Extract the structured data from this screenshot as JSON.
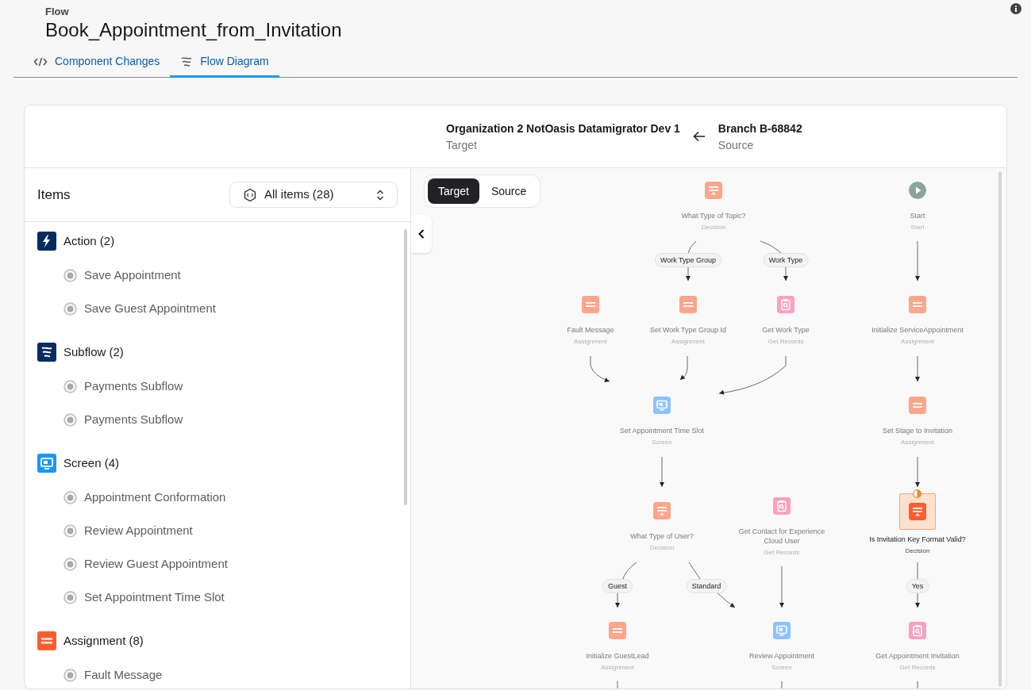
{
  "header": {
    "eyebrow": "Flow",
    "title": "Book_Appointment_from_Invitation"
  },
  "tabs": [
    {
      "label": "Component Changes",
      "kind": "code",
      "selected": false
    },
    {
      "label": "Flow Diagram",
      "kind": "flow",
      "selected": true
    }
  ],
  "comparison": {
    "target": {
      "name": "Organization 2 NotOasis Datamigrator Dev 1",
      "role": "Target"
    },
    "source": {
      "name": "Branch B-68842",
      "role": "Source"
    }
  },
  "items_panel": {
    "title": "Items",
    "filter": "All items (28)",
    "groups": [
      {
        "label": "Action (2)",
        "kind": "action",
        "color": "#032d60",
        "items": [
          "Save Appointment",
          "Save Guest Appointment"
        ]
      },
      {
        "label": "Subflow (2)",
        "kind": "subflow",
        "color": "#032d60",
        "items": [
          "Payments Subflow",
          "Payments Subflow"
        ]
      },
      {
        "label": "Screen (4)",
        "kind": "screen",
        "color": "#1b96ff",
        "items": [
          "Appointment Conformation",
          "Review Appointment",
          "Review Guest Appointment",
          "Set Appointment Time Slot"
        ]
      },
      {
        "label": "Assignment (8)",
        "kind": "assignment",
        "color": "#ff5d2d",
        "items": [
          "Fault Message"
        ]
      }
    ]
  },
  "diagram": {
    "view_toggle": [
      {
        "label": "Target",
        "selected": true
      },
      {
        "label": "Source",
        "selected": false
      }
    ],
    "nodes": [
      {
        "label": "What Type of Topic?",
        "type_label": "Decision",
        "kind": "decision",
        "highlighted": false
      },
      {
        "label": "Start",
        "type_label": "Start",
        "kind": "start",
        "highlighted": false
      },
      {
        "label": "Fault Message",
        "type_label": "Assignment",
        "kind": "assignment",
        "highlighted": false
      },
      {
        "label": "Set Work Type Group Id",
        "type_label": "Assignment",
        "kind": "assignment",
        "highlighted": false
      },
      {
        "label": "Get Work Type",
        "type_label": "Get Records",
        "kind": "records",
        "highlighted": false
      },
      {
        "label": "Initialize ServiceAppointment",
        "type_label": "Assignment",
        "kind": "assignment",
        "highlighted": false
      },
      {
        "label": "Set Appointment Time Slot",
        "type_label": "Screen",
        "kind": "screen",
        "highlighted": false
      },
      {
        "label": "Set Stage to Invitation",
        "type_label": "Assignment",
        "kind": "assignment",
        "highlighted": false
      },
      {
        "label": "What Type of User?",
        "type_label": "Decision",
        "kind": "decision",
        "highlighted": false
      },
      {
        "label": "Get Contact for Experience Cloud User",
        "type_label": "Get Records",
        "kind": "records",
        "highlighted": false
      },
      {
        "label": "Is Invitation Key Format Valid?",
        "type_label": "Decision",
        "kind": "decision",
        "highlighted": true
      },
      {
        "label": "Initialize GuestLead",
        "type_label": "Assignment",
        "kind": "assignment",
        "highlighted": false
      },
      {
        "label": "Review Appointment",
        "type_label": "Screen",
        "kind": "screen",
        "highlighted": false
      },
      {
        "label": "Get Appointment Invitation",
        "type_label": "Get Records",
        "kind": "records",
        "highlighted": false
      }
    ],
    "branch_labels": [
      "Work Type Group",
      "Work Type",
      "Guest",
      "Standard",
      "Yes"
    ]
  }
}
